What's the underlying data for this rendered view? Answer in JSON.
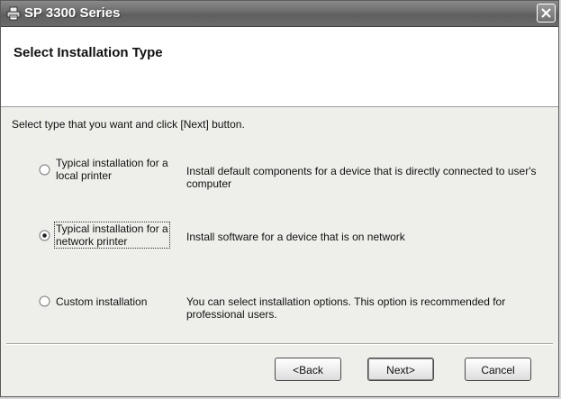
{
  "window": {
    "title": "SP 3300 Series"
  },
  "header": {
    "title": "Select Installation Type"
  },
  "instruction": "Select type that you want and click [Next] button.",
  "options": [
    {
      "label_line1": "Typical installation for a",
      "label_line2": "local printer",
      "description_line1": "Install default components for a device that is directly connected to user's",
      "description_line2": "computer",
      "selected": false
    },
    {
      "label_line1": "Typical installation for a",
      "label_line2": "network printer",
      "description_line1": "Install software for a device that is on network",
      "description_line2": "",
      "selected": true
    },
    {
      "label_line1": "Custom installation",
      "label_line2": "",
      "description_line1": "You can select installation options. This option is recommended for",
      "description_line2": "professional users.",
      "selected": false
    }
  ],
  "buttons": {
    "back": "<Back",
    "next": "Next>",
    "cancel": "Cancel"
  },
  "icons": {
    "app": "printer-icon",
    "close": "close-icon"
  }
}
